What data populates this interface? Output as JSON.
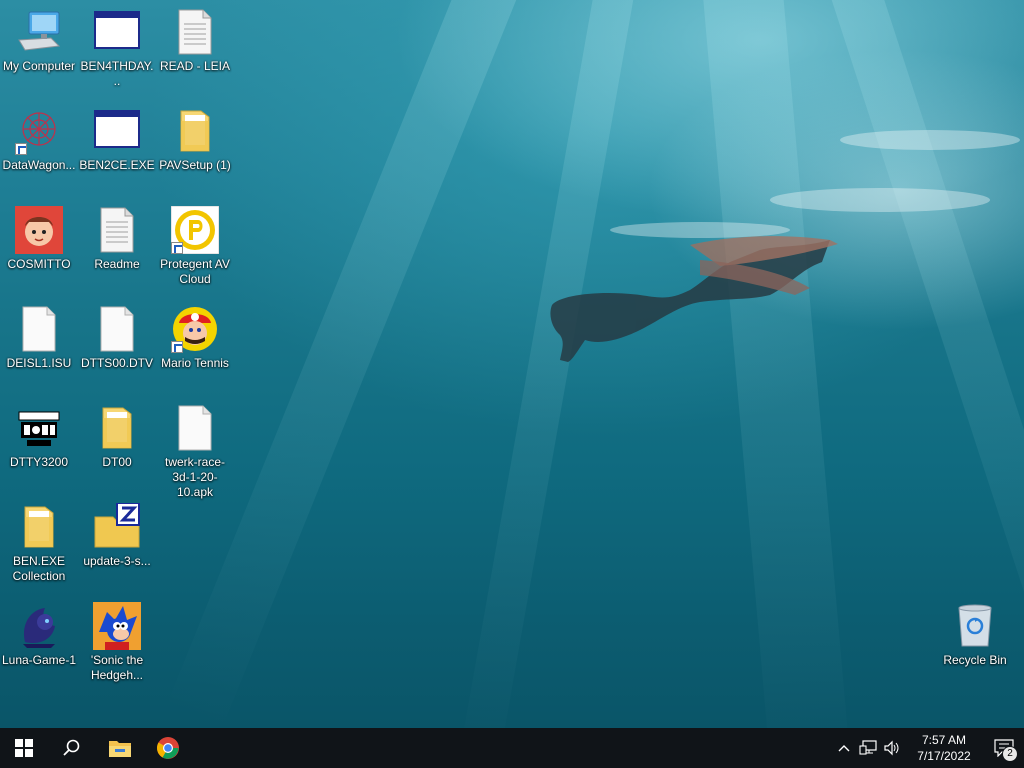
{
  "desktop": {
    "icons": [
      {
        "label": "My Computer",
        "icon": "computer-icon"
      },
      {
        "label": "BEN4THDAY...",
        "icon": "window-app-icon"
      },
      {
        "label": "READ - LEIA",
        "icon": "text-file-icon"
      },
      {
        "label": "DataWagon...",
        "icon": "datawagon-icon"
      },
      {
        "label": "BEN2CE.EXE",
        "icon": "window-app-icon"
      },
      {
        "label": "PAVSetup (1)",
        "icon": "folder-icon"
      },
      {
        "label": "COSMITTO",
        "icon": "cosmitto-avatar-icon"
      },
      {
        "label": "Readme",
        "icon": "text-file-icon"
      },
      {
        "label": "Protegent  AV Cloud",
        "icon": "protegent-icon"
      },
      {
        "label": "DEISL1.ISU",
        "icon": "blank-file-icon"
      },
      {
        "label": "DTTS00.DTV",
        "icon": "blank-file-icon"
      },
      {
        "label": "Mario Tennis",
        "icon": "mario-icon"
      },
      {
        "label": "DTTY3200",
        "icon": "desktop-toys-icon"
      },
      {
        "label": "DT00",
        "icon": "folder-icon"
      },
      {
        "label": "twerk-race-3d-1-20-10.apk",
        "icon": "blank-file-icon"
      },
      {
        "label": "BEN.EXE Collection",
        "icon": "folder-icon"
      },
      {
        "label": "update-3-s...",
        "icon": "zip-folder-icon"
      },
      {
        "label": "Luna-Game-1",
        "icon": "luna-icon"
      },
      {
        "label": "'Sonic the Hedgeh...",
        "icon": "sonic-icon"
      },
      {
        "label": "Recycle Bin",
        "icon": "recycle-bin-icon"
      }
    ]
  },
  "taskbar": {
    "time": "7:57 AM",
    "date": "7/17/2022",
    "notification_count": "2",
    "accent": "#101418"
  }
}
